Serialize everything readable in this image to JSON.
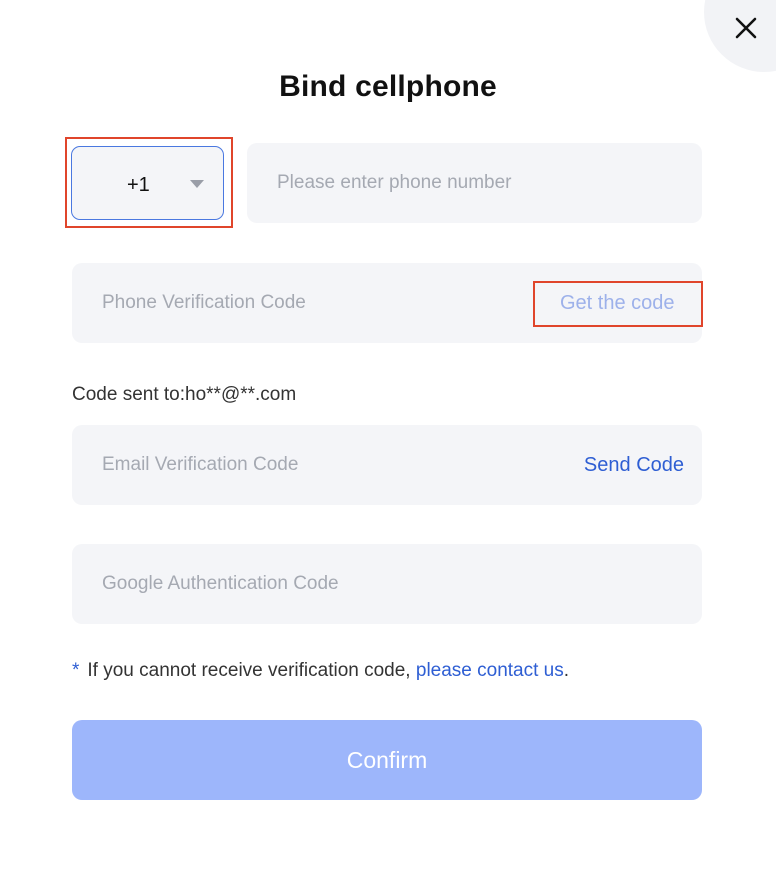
{
  "dialog": {
    "title": "Bind cellphone",
    "close_icon": "close-icon"
  },
  "phone": {
    "country_code": "+1",
    "country_arrow_icon": "chevron-down-icon",
    "number_placeholder": "Please enter phone number"
  },
  "phone_code": {
    "placeholder": "Phone Verification Code",
    "action_label": "Get the code"
  },
  "email_code": {
    "sent_label": "Code sent to:ho**@**.com",
    "placeholder": "Email Verification Code",
    "action_label": "Send Code"
  },
  "google_code": {
    "placeholder": "Google Authentication Code"
  },
  "notice": {
    "star": "*",
    "text": "If you cannot receive verification code,",
    "link": "please contact us",
    "suffix": "."
  },
  "confirm_label": "Confirm",
  "colors": {
    "accent": "#2e5ed3",
    "confirm_bg": "#9db6fb",
    "field_bg": "#f4f5f8",
    "highlight": "#e0452b"
  }
}
